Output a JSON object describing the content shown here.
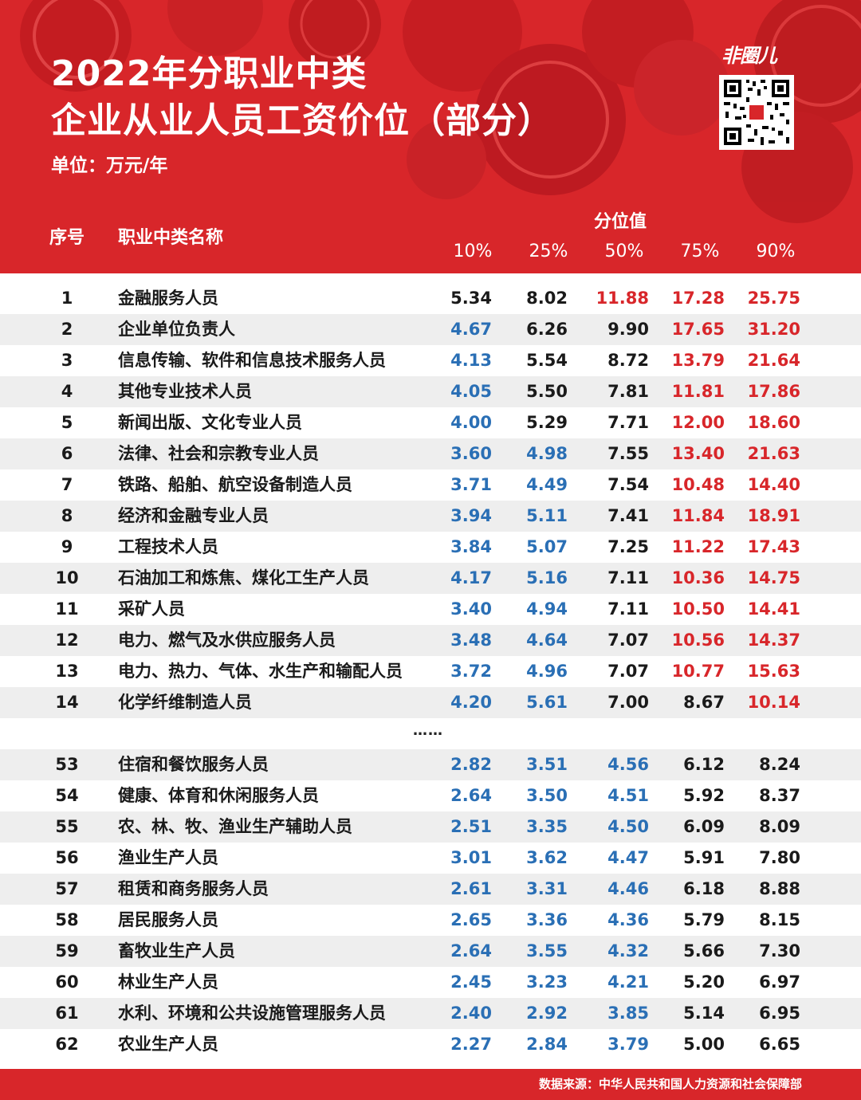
{
  "header": {
    "title_line1": "2022年分职业中类",
    "title_line2": "企业从业人员工资价位（部分）",
    "unit": "单位：万元/年",
    "brand": "非圈儿"
  },
  "footer": {
    "source": "数据来源：中华人民共和国人力资源和社会保障部"
  },
  "colors": {
    "brand_red": "#d8262a",
    "value_red": "#d8262a",
    "value_blue": "#2a6fb5",
    "value_black": "#1a1a1a",
    "row_alt": "#eeeeee"
  },
  "chart_data": {
    "type": "table",
    "title": "2022年分职业中类企业从业人员工资价位（部分）",
    "unit": "万元/年",
    "columns": {
      "index": "序号",
      "name": "职业中类名称",
      "group": "分位值",
      "percentiles": [
        "10%",
        "25%",
        "50%",
        "75%",
        "90%"
      ]
    },
    "ellipsis": "……",
    "rows": [
      {
        "index": "1",
        "name": "金融服务人员",
        "values": [
          "5.34",
          "8.02",
          "11.88",
          "17.28",
          "25.75"
        ],
        "colors": [
          "k",
          "k",
          "r",
          "r",
          "r"
        ]
      },
      {
        "index": "2",
        "name": "企业单位负责人",
        "values": [
          "4.67",
          "6.26",
          "9.90",
          "17.65",
          "31.20"
        ],
        "colors": [
          "b",
          "k",
          "k",
          "r",
          "r"
        ]
      },
      {
        "index": "3",
        "name": "信息传输、软件和信息技术服务人员",
        "values": [
          "4.13",
          "5.54",
          "8.72",
          "13.79",
          "21.64"
        ],
        "colors": [
          "b",
          "k",
          "k",
          "r",
          "r"
        ]
      },
      {
        "index": "4",
        "name": "其他专业技术人员",
        "values": [
          "4.05",
          "5.50",
          "7.81",
          "11.81",
          "17.86"
        ],
        "colors": [
          "b",
          "k",
          "k",
          "r",
          "r"
        ]
      },
      {
        "index": "5",
        "name": "新闻出版、文化专业人员",
        "values": [
          "4.00",
          "5.29",
          "7.71",
          "12.00",
          "18.60"
        ],
        "colors": [
          "b",
          "k",
          "k",
          "r",
          "r"
        ]
      },
      {
        "index": "6",
        "name": "法律、社会和宗教专业人员",
        "values": [
          "3.60",
          "4.98",
          "7.55",
          "13.40",
          "21.63"
        ],
        "colors": [
          "b",
          "b",
          "k",
          "r",
          "r"
        ]
      },
      {
        "index": "7",
        "name": "铁路、船舶、航空设备制造人员",
        "values": [
          "3.71",
          "4.49",
          "7.54",
          "10.48",
          "14.40"
        ],
        "colors": [
          "b",
          "b",
          "k",
          "r",
          "r"
        ]
      },
      {
        "index": "8",
        "name": "经济和金融专业人员",
        "values": [
          "3.94",
          "5.11",
          "7.41",
          "11.84",
          "18.91"
        ],
        "colors": [
          "b",
          "b",
          "k",
          "r",
          "r"
        ]
      },
      {
        "index": "9",
        "name": "工程技术人员",
        "values": [
          "3.84",
          "5.07",
          "7.25",
          "11.22",
          "17.43"
        ],
        "colors": [
          "b",
          "b",
          "k",
          "r",
          "r"
        ]
      },
      {
        "index": "10",
        "name": "石油加工和炼焦、煤化工生产人员",
        "values": [
          "4.17",
          "5.16",
          "7.11",
          "10.36",
          "14.75"
        ],
        "colors": [
          "b",
          "b",
          "k",
          "r",
          "r"
        ]
      },
      {
        "index": "11",
        "name": "采矿人员",
        "values": [
          "3.40",
          "4.94",
          "7.11",
          "10.50",
          "14.41"
        ],
        "colors": [
          "b",
          "b",
          "k",
          "r",
          "r"
        ]
      },
      {
        "index": "12",
        "name": "电力、燃气及水供应服务人员",
        "values": [
          "3.48",
          "4.64",
          "7.07",
          "10.56",
          "14.37"
        ],
        "colors": [
          "b",
          "b",
          "k",
          "r",
          "r"
        ]
      },
      {
        "index": "13",
        "name": "电力、热力、气体、水生产和输配人员",
        "values": [
          "3.72",
          "4.96",
          "7.07",
          "10.77",
          "15.63"
        ],
        "colors": [
          "b",
          "b",
          "k",
          "r",
          "r"
        ]
      },
      {
        "index": "14",
        "name": "化学纤维制造人员",
        "values": [
          "4.20",
          "5.61",
          "7.00",
          "8.67",
          "10.14"
        ],
        "colors": [
          "b",
          "b",
          "k",
          "k",
          "r"
        ]
      },
      {
        "index": "53",
        "name": "住宿和餐饮服务人员",
        "values": [
          "2.82",
          "3.51",
          "4.56",
          "6.12",
          "8.24"
        ],
        "colors": [
          "b",
          "b",
          "b",
          "k",
          "k"
        ]
      },
      {
        "index": "54",
        "name": "健康、体育和休闲服务人员",
        "values": [
          "2.64",
          "3.50",
          "4.51",
          "5.92",
          "8.37"
        ],
        "colors": [
          "b",
          "b",
          "b",
          "k",
          "k"
        ]
      },
      {
        "index": "55",
        "name": "农、林、牧、渔业生产辅助人员",
        "values": [
          "2.51",
          "3.35",
          "4.50",
          "6.09",
          "8.09"
        ],
        "colors": [
          "b",
          "b",
          "b",
          "k",
          "k"
        ]
      },
      {
        "index": "56",
        "name": "渔业生产人员",
        "values": [
          "3.01",
          "3.62",
          "4.47",
          "5.91",
          "7.80"
        ],
        "colors": [
          "b",
          "b",
          "b",
          "k",
          "k"
        ]
      },
      {
        "index": "57",
        "name": "租赁和商务服务人员",
        "values": [
          "2.61",
          "3.31",
          "4.46",
          "6.18",
          "8.88"
        ],
        "colors": [
          "b",
          "b",
          "b",
          "k",
          "k"
        ]
      },
      {
        "index": "58",
        "name": "居民服务人员",
        "values": [
          "2.65",
          "3.36",
          "4.36",
          "5.79",
          "8.15"
        ],
        "colors": [
          "b",
          "b",
          "b",
          "k",
          "k"
        ]
      },
      {
        "index": "59",
        "name": "畜牧业生产人员",
        "values": [
          "2.64",
          "3.55",
          "4.32",
          "5.66",
          "7.30"
        ],
        "colors": [
          "b",
          "b",
          "b",
          "k",
          "k"
        ]
      },
      {
        "index": "60",
        "name": "林业生产人员",
        "values": [
          "2.45",
          "3.23",
          "4.21",
          "5.20",
          "6.97"
        ],
        "colors": [
          "b",
          "b",
          "b",
          "k",
          "k"
        ]
      },
      {
        "index": "61",
        "name": "水利、环境和公共设施管理服务人员",
        "values": [
          "2.40",
          "2.92",
          "3.85",
          "5.14",
          "6.95"
        ],
        "colors": [
          "b",
          "b",
          "b",
          "k",
          "k"
        ]
      },
      {
        "index": "62",
        "name": "农业生产人员",
        "values": [
          "2.27",
          "2.84",
          "3.79",
          "5.00",
          "6.65"
        ],
        "colors": [
          "b",
          "b",
          "b",
          "k",
          "k"
        ]
      }
    ]
  }
}
